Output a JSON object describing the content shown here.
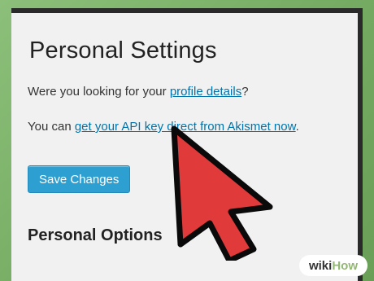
{
  "page": {
    "title": "Personal Settings",
    "line1": {
      "prefix": "Were you looking for your ",
      "link": "profile details",
      "suffix": "?"
    },
    "line2": {
      "prefix": "You can ",
      "link": "get your API key direct from Akismet now",
      "suffix": "."
    },
    "save_button": "Save Changes",
    "section_heading": "Personal Options"
  },
  "watermark": {
    "part1": "wiki",
    "part2": "How"
  },
  "colors": {
    "link": "#0073aa",
    "button": "#2e9fd1",
    "cursor_fill": "#e03a3a",
    "background_green": "#7fb36b"
  },
  "icons": {
    "cursor": "arrow-cursor-icon"
  }
}
